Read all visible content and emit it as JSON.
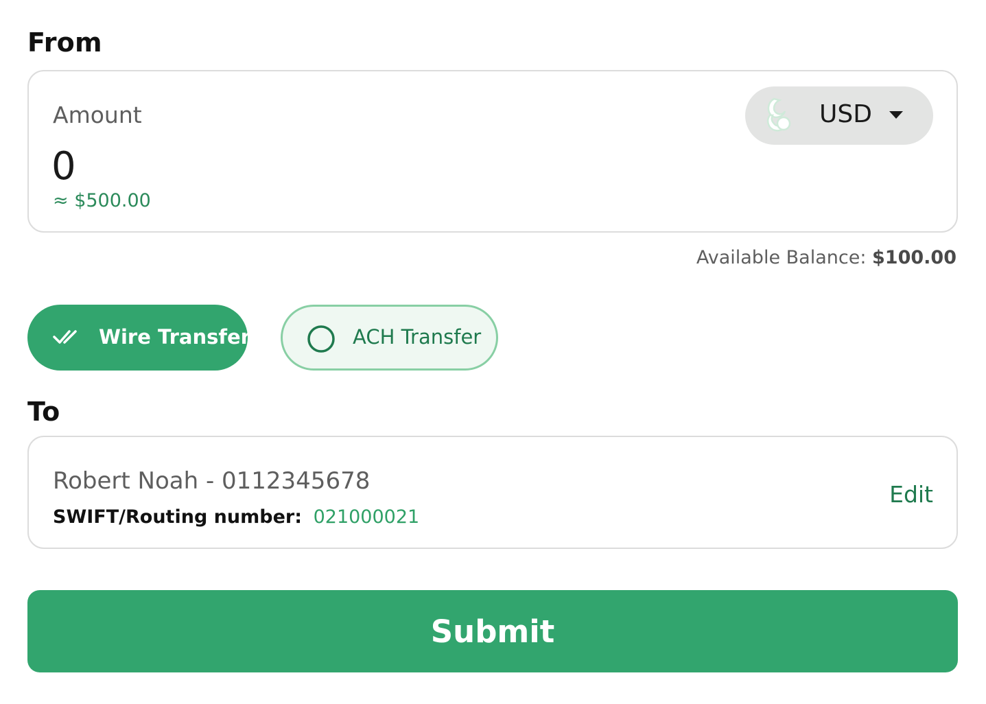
{
  "from": {
    "title": "From",
    "amount_label": "Amount",
    "amount_value": "0",
    "approx_value": "≈ $500.00",
    "currency": {
      "code": "USD",
      "icon": "currency-logo-icon",
      "caret_icon": "caret-down-icon"
    },
    "balance": {
      "label": "Available Balance:",
      "value": "$100.00"
    }
  },
  "transfer_types": {
    "wire": {
      "label": "Wire Transfer",
      "icon": "double-check-icon",
      "selected": true
    },
    "ach": {
      "label": "ACH Transfer",
      "icon": "radio-circle-icon",
      "selected": false
    }
  },
  "to": {
    "title": "To",
    "recipient": "Robert Noah - 0112345678",
    "routing_label": "SWIFT/Routing number:",
    "routing_value": "021000021",
    "edit_label": "Edit"
  },
  "submit_label": "Submit",
  "colors": {
    "primary": "#32a56e",
    "primary_dark": "#1f7a4e",
    "chip_light_bg": "#eff8f2",
    "chip_light_border": "#88cfa4",
    "card_border": "#dcdcdc",
    "currency_bg": "#e3e4e3"
  }
}
